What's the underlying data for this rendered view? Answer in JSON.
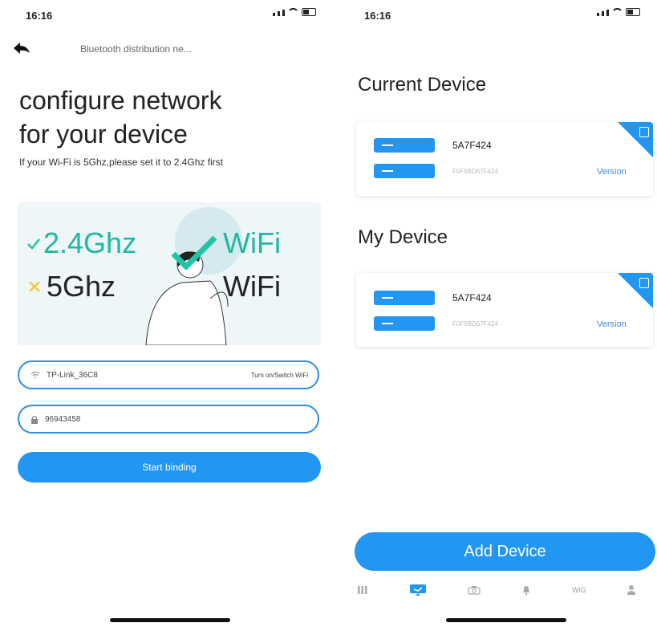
{
  "left": {
    "status_time": "16:16",
    "nav_title": "Bluetooth distribution ne...",
    "title_line1": "configure network",
    "title_line2": "for your device",
    "hint": "If your Wi-Fi is 5Ghz,please set it to 2.4Ghz first",
    "banner": {
      "row1_freq": "2.4Ghz",
      "row1_wifi": "WiFi",
      "row2_freq": "5Ghz",
      "row2_wifi": "WiFi"
    },
    "wifi_field": {
      "value": "TP-Link_36C8",
      "action": "Turn on/Switch WiFi"
    },
    "password_field": {
      "value": "96943458"
    },
    "start_button": "Start binding"
  },
  "right": {
    "status_time": "16:16",
    "current_heading": "Current Device",
    "my_heading": "My Device",
    "current_device": {
      "name": "5A7F424",
      "id": "F0F5BD67F424",
      "version_label": "Version"
    },
    "my_device": {
      "name": "5A7F424",
      "id": "F0F5BD67F424",
      "version_label": "Version"
    },
    "add_button": "Add Device",
    "tabs": [
      {
        "icon": "grid-icon",
        "label": ""
      },
      {
        "icon": "device-icon",
        "label": ""
      },
      {
        "icon": "camera-icon",
        "label": ""
      },
      {
        "icon": "bell-icon",
        "label": ""
      },
      {
        "icon": "wifi-text-icon",
        "label": "WiG"
      },
      {
        "icon": "profile-icon",
        "label": ""
      }
    ]
  },
  "colors": {
    "accent": "#2196f3",
    "check": "#20c4a6",
    "cross": "#f5c842"
  }
}
